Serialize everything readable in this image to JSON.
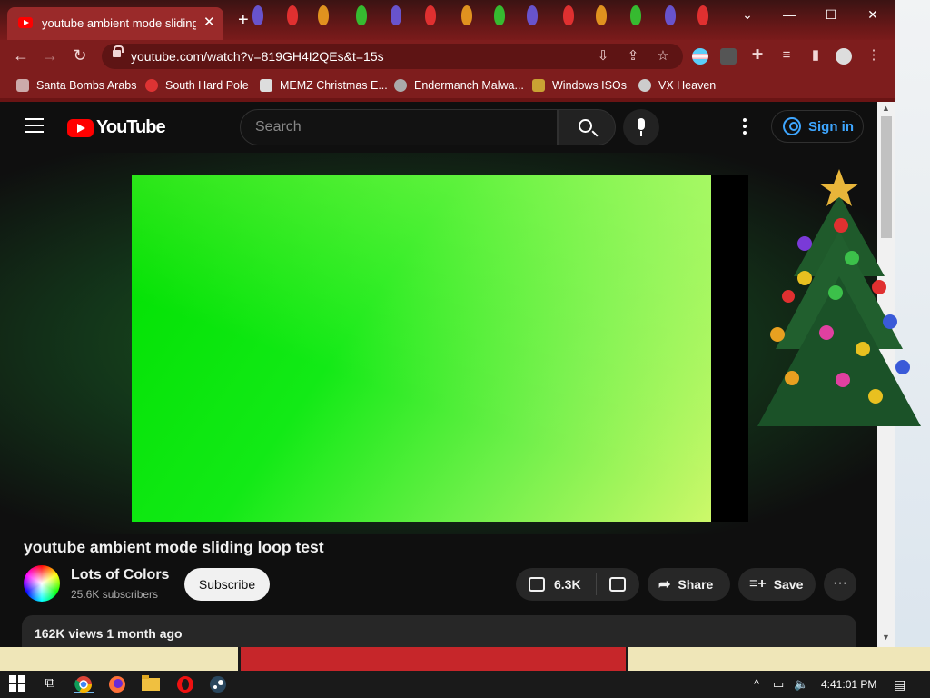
{
  "browser": {
    "tab_title": "youtube ambient mode sliding l",
    "new_tab": "+",
    "url": "youtube.com/watch?v=819GH4I2QEs&t=15s",
    "bookmarks": [
      {
        "label": "Santa Bombs Arabs",
        "icon": "bookmark-icon-santa",
        "color": "#caa"
      },
      {
        "label": "South Hard Pole",
        "icon": "bookmark-icon-star",
        "color": "#d33"
      },
      {
        "label": "MEMZ Christmas E...",
        "icon": "bookmark-icon-image",
        "color": "#ddd"
      },
      {
        "label": "Endermanch Malwa...",
        "icon": "bookmark-icon-face",
        "color": "#aaa"
      },
      {
        "label": "Windows ISOs",
        "icon": "bookmark-icon-cone",
        "color": "#c9a233"
      },
      {
        "label": "VX Heaven",
        "icon": "bookmark-icon-skull",
        "color": "#ccc"
      }
    ]
  },
  "youtube": {
    "logo_text": "YouTube",
    "search_placeholder": "Search",
    "sign_in": "Sign in",
    "video_title": "youtube ambient mode sliding loop test",
    "channel_name": "Lots of Colors",
    "subscribers": "25.6K subscribers",
    "subscribe": "Subscribe",
    "likes": "6.3K",
    "share": "Share",
    "save": "Save",
    "more": "···",
    "views": "162K views  1 month ago"
  },
  "taskbar": {
    "clock": "4:41:01 PM"
  },
  "colors": {
    "accent": "#3ea6ff",
    "titlebar": "#7e1d1d",
    "youtube_red": "#ff0000"
  }
}
